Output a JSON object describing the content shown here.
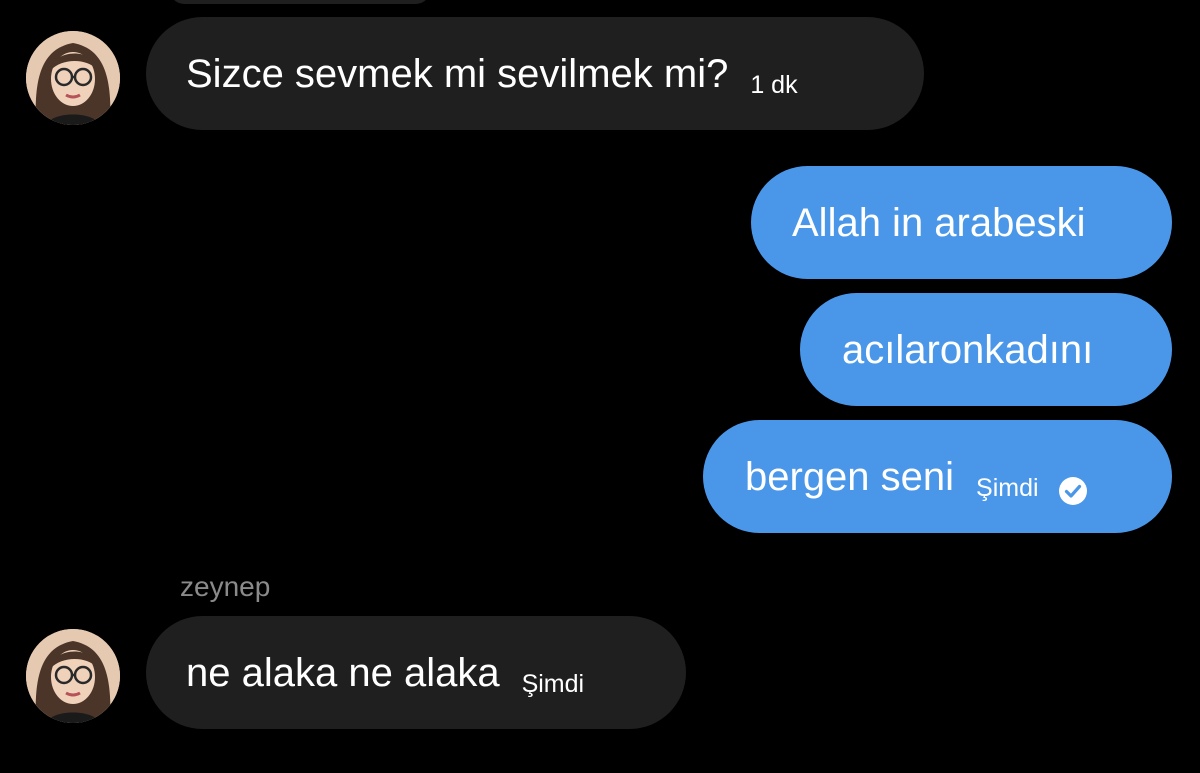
{
  "colors": {
    "background": "#000000",
    "incoming_bubble": "#1f1f1f",
    "outgoing_bubble": "#4a97e9",
    "text": "#ffffff",
    "sender_name": "#8a8a8a"
  },
  "messages": [
    {
      "direction": "incoming",
      "text": "Sizce sevmek mi sevilmek mi?",
      "time": "1 dk",
      "avatar": "avatar-icon"
    },
    {
      "direction": "outgoing",
      "text": "Allah in arabeski"
    },
    {
      "direction": "outgoing",
      "text": "acılaronkadını"
    },
    {
      "direction": "outgoing",
      "text": "bergen seni",
      "time": "Şimdi",
      "status_icon": "check-circle-icon"
    },
    {
      "direction": "incoming",
      "sender": "zeynep",
      "text": "ne alaka ne alaka",
      "time": "Şimdi",
      "avatar": "avatar-icon"
    }
  ]
}
